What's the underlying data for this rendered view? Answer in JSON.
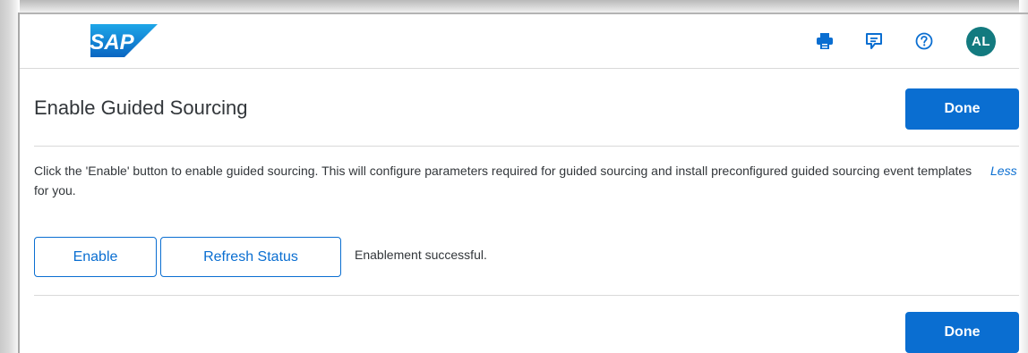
{
  "header": {
    "logo_text": "SAP",
    "avatar_initials": "AL",
    "icons": [
      "print-icon",
      "feedback-icon",
      "help-icon"
    ]
  },
  "page": {
    "title": "Enable Guided Sourcing",
    "done_label": "Done",
    "description": "Click the 'Enable' button to enable guided sourcing. This will configure parameters required for guided sourcing and install preconfigured guided sourcing event templates for you.",
    "less_link": "Less",
    "enable_label": "Enable",
    "refresh_label": "Refresh Status",
    "status_message": "Enablement successful."
  },
  "colors": {
    "accent": "#0a6ed1",
    "avatar_bg": "#137a7f",
    "text": "#32363a",
    "divider": "#d9d9d9"
  }
}
